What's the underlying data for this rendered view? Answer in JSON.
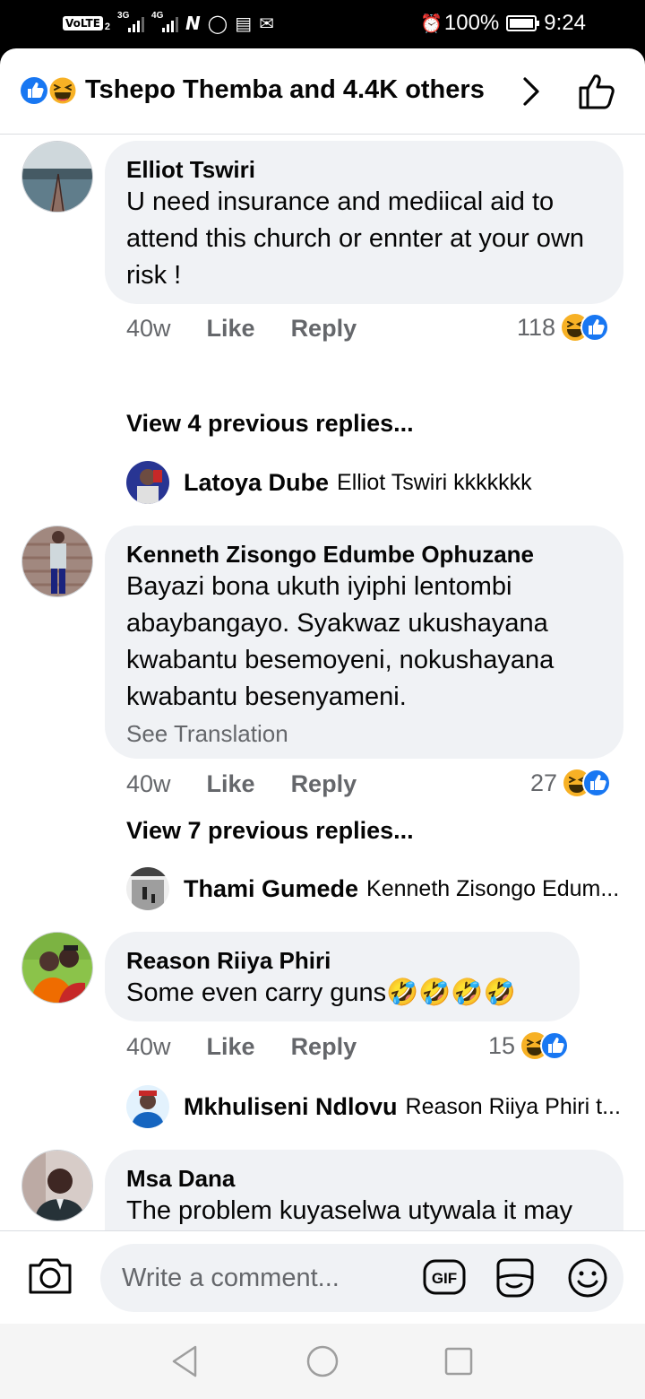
{
  "status_bar": {
    "volte": "VoLTE",
    "sim": "2",
    "net1": "3G",
    "net2": "4G",
    "battery": "100%",
    "time": "9:24"
  },
  "header": {
    "title": "Tshepo Themba and 4.4K others"
  },
  "comments": [
    {
      "name": "Elliot Tswiri",
      "text": "U need insurance and mediical aid to attend this church or ennter at your own risk !",
      "time": "40w",
      "like": "Like",
      "reply": "Reply",
      "reaction_count": "118",
      "view_previous": "View 4 previous replies...",
      "latest_reply": {
        "name": "Latoya Dube",
        "text": "Elliot Tswiri kkkkkkk"
      }
    },
    {
      "name": "Kenneth Zisongo Edumbe Ophuzane",
      "text": "Bayazi bona ukuth iyiphi lentombi abaybangayo. Syakwaz ukushayana kwabantu besemoyeni, nokushayana kwabantu besenyameni.",
      "see_translation": "See Translation",
      "time": "40w",
      "like": "Like",
      "reply": "Reply",
      "reaction_count": "27",
      "view_previous": "View 7 previous replies...",
      "latest_reply": {
        "name": "Thami Gumede",
        "text": "Kenneth Zisongo Edum..."
      }
    },
    {
      "name": "Reason Riiya Phiri",
      "text": "Some even carry guns🤣🤣🤣🤣",
      "time": "40w",
      "like": "Like",
      "reply": "Reply",
      "reaction_count": "15",
      "latest_reply": {
        "name": "Mkhuliseni Ndlovu",
        "text": "Reason Riiya Phiri t..."
      }
    },
    {
      "name": "Msa Dana",
      "text": "The problem kuyaselwa utywala it may happen badakiwe🤔"
    }
  ],
  "composer": {
    "placeholder": "Write a comment..."
  },
  "colors": {
    "facebook_blue": "#1877f2",
    "bubble_bg": "#f0f2f5",
    "secondary_text": "#65676b",
    "haha_yellow": "#f7b125"
  },
  "icons": [
    "like-reaction-icon",
    "haha-reaction-icon",
    "chevron-right-icon",
    "thumbs-up-icon",
    "camera-icon",
    "gif-icon",
    "sticker-icon",
    "smiley-icon",
    "nav-back-icon",
    "nav-home-icon",
    "nav-recents-icon"
  ]
}
